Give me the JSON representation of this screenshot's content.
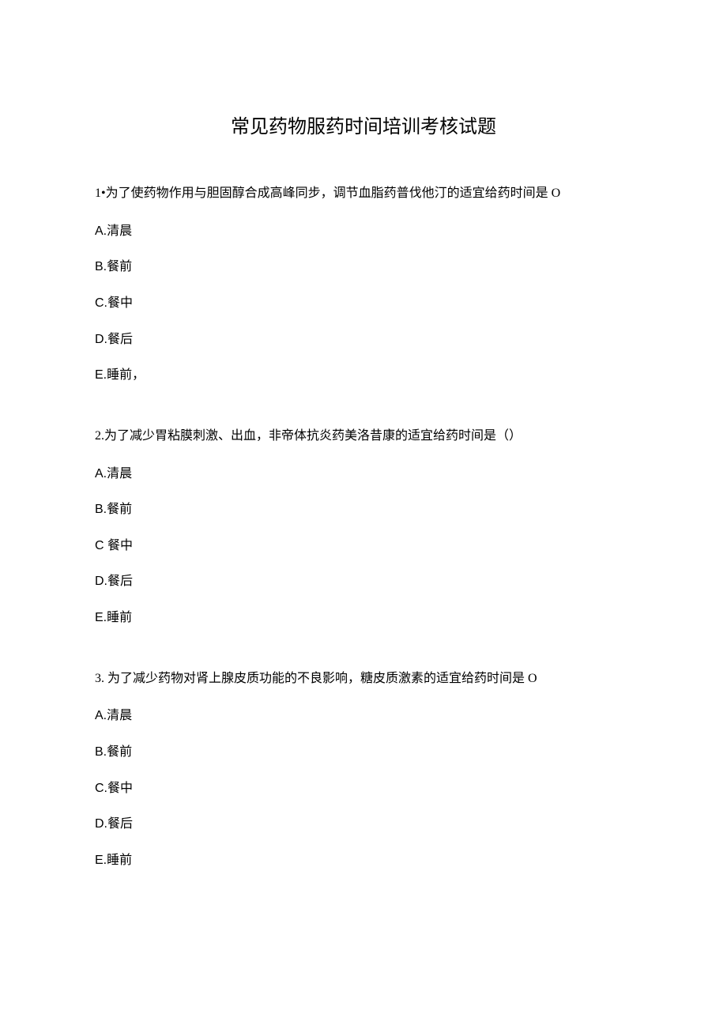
{
  "title": "常见药物服药时间培训考核试题",
  "questions": [
    {
      "text": "1•为了使药物作用与胆固醇合成高峰同步，调节血脂药普伐他汀的适宜给药时间是 O",
      "options": [
        {
          "letter": "A.",
          "text": "清晨"
        },
        {
          "letter": "B.",
          "text": "餐前"
        },
        {
          "letter": "C.",
          "text": "餐中"
        },
        {
          "letter": "D.",
          "text": "餐后"
        },
        {
          "letter": "E.",
          "text": "睡前，"
        }
      ]
    },
    {
      "text": "2.为了减少胃粘膜刺激、出血，非帝体抗炎药美洛昔康的适宜给药时间是（）",
      "options": [
        {
          "letter": "A.",
          "text": "清晨"
        },
        {
          "letter": "B.",
          "text": "餐前"
        },
        {
          "letter": "C ",
          "text": "餐中"
        },
        {
          "letter": "D.",
          "text": "餐后"
        },
        {
          "letter": "E.",
          "text": "睡前"
        }
      ]
    },
    {
      "text": "3. 为了减少药物对肾上腺皮质功能的不良影响，糖皮质激素的适宜给药时间是 O",
      "options": [
        {
          "letter": "A.",
          "text": "清晨"
        },
        {
          "letter": "B.",
          "text": "餐前"
        },
        {
          "letter": "C.",
          "text": "餐中"
        },
        {
          "letter": "D.",
          "text": "餐后"
        },
        {
          "letter": "E.",
          "text": "睡前"
        }
      ]
    }
  ]
}
